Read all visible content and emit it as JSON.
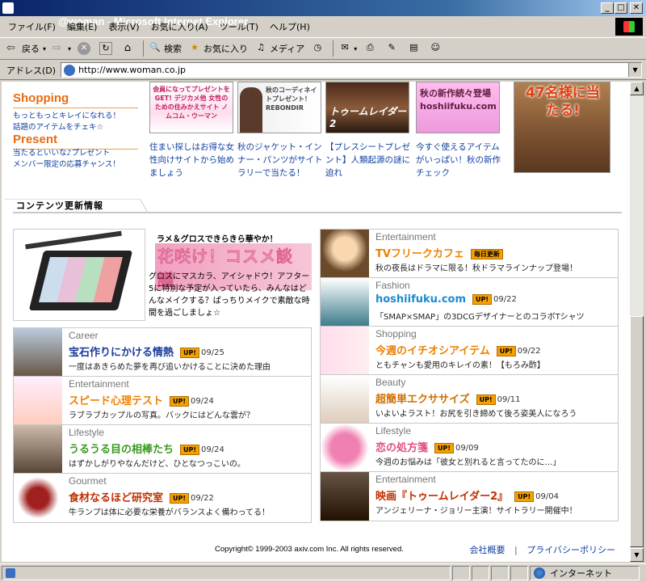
{
  "window": {
    "title": "@woman - Microsoft Internet Explorer"
  },
  "menu": [
    "ファイル(F)",
    "編集(E)",
    "表示(V)",
    "お気に入り(A)",
    "ツール(T)",
    "ヘルプ(H)"
  ],
  "toolbar": {
    "back": "戻る",
    "search": "検索",
    "favorites": "お気に入り",
    "media": "メディア"
  },
  "address": {
    "label": "アドレス(D)",
    "url": "http://www.woman.co.jp"
  },
  "promos": [
    {
      "heading": "Shopping",
      "lines": [
        "もっともっとキレイになれる！",
        "話題のアイテムをチェキ☆"
      ]
    },
    {
      "heading": "Present",
      "lines": [
        "当たるといいな♪プレゼント",
        "メンバー限定の応募チャンス！"
      ]
    }
  ],
  "banners": [
    {
      "img_text": "会員になってプレゼントをGET! デジカメ他 女性のための住みかえサイト ノムコム・ウーマン",
      "caption": "住まい探しはお得な女性向けサイトから始めましょう"
    },
    {
      "img_text": "秋のコーディネイトプレゼント！ REBONDIR",
      "caption": "秋のジャケット・インナー・パンツがサイトラリーで当たる！"
    },
    {
      "img_text": "トゥームレイダー2",
      "caption": "【プレスシートプレゼント】人類起源の謎に迫れ"
    },
    {
      "img_text": "秋の新作続々登場 hoshiifuku.com",
      "caption": "今すぐ使えるアイテムがいっぱい！秋の新作チェック"
    }
  ],
  "big_banner": {
    "text": "47名様に当たる!"
  },
  "section": {
    "title": "コンテンツ更新情報"
  },
  "feature": {
    "tagline": "ラメ＆グロスできらきら華やか！",
    "title": "花咲け！コスメ談議",
    "body": "グロスにマスカラ、アイシャドウ！アフター5に特別な予定が入っていたら、みんなはどんなメイクする？ぱっちりメイクで素敵な時間を過ごしましょ☆"
  },
  "items_left": [
    {
      "category": "Career",
      "title": "宝石作りにかける情熱",
      "title_color": "#1a3a9a",
      "badge": "UP!",
      "date": "09/25",
      "desc": "一度はあきらめた夢を再び追いかけることに決めた理由"
    },
    {
      "category": "Entertainment",
      "title": "スピード心理テスト",
      "title_color": "#f08000",
      "badge": "UP!",
      "date": "09/24",
      "desc": "ラブラブカップルの写真。バックにはどんな雲が？"
    },
    {
      "category": "Lifestyle",
      "title": "うるうる目の相棒たち",
      "title_color": "#3a9a20",
      "badge": "UP!",
      "date": "09/24",
      "desc": "はずかしがりやなんだけど、ひとなつっこいの。"
    },
    {
      "category": "Gourmet",
      "title": "食材なるほど研究室",
      "title_color": "#c03000",
      "badge": "UP!",
      "date": "09/22",
      "desc": "牛ランプは体に必要な栄養がバランスよく備わってる！"
    }
  ],
  "items_right": [
    {
      "category": "Entertainment",
      "title": "TVフリークカフェ",
      "title_color": "#f08000",
      "badge": "毎日更新",
      "date": "",
      "desc": "秋の夜長はドラマに限る！秋ドラマラインナップ登場！"
    },
    {
      "category": "Fashion",
      "title": "hoshiifuku.com",
      "title_color": "#1a8ad0",
      "badge": "UP!",
      "date": "09/22",
      "desc": "「SMAP×SMAP」の3DCGデザイナーとのコラボTシャツ"
    },
    {
      "category": "Shopping",
      "title": "今週のイチオシアイテム",
      "title_color": "#f08000",
      "badge": "UP!",
      "date": "09/22",
      "desc": "ともチャンも愛用のキレイの素！【もろみ酢】"
    },
    {
      "category": "Beauty",
      "title": "超簡単エクササイズ",
      "title_color": "#d07000",
      "badge": "UP!",
      "date": "09/11",
      "desc": "いよいよラスト！お尻を引き締めて後ろ姿美人になろう"
    },
    {
      "category": "Lifestyle",
      "title": "恋の処方箋",
      "title_color": "#e0507a",
      "badge": "UP!",
      "date": "09/09",
      "desc": "今週のお悩みは「彼女と別れると言ってたのに…」"
    },
    {
      "category": "Entertainment",
      "title": "映画『トゥームレイダー2』",
      "title_color": "#c03000",
      "badge": "UP!",
      "date": "09/04",
      "desc": "アンジェリーナ・ジョリー主演！サイトラリー開催中！"
    }
  ],
  "footer": {
    "copyright": "Copyright© 1999-2003 axiv.com Inc. All rights reserved.",
    "link1": "会社概要",
    "sep": "|",
    "link2": "プライバシーポリシー"
  },
  "status": {
    "zone": "インターネット"
  }
}
